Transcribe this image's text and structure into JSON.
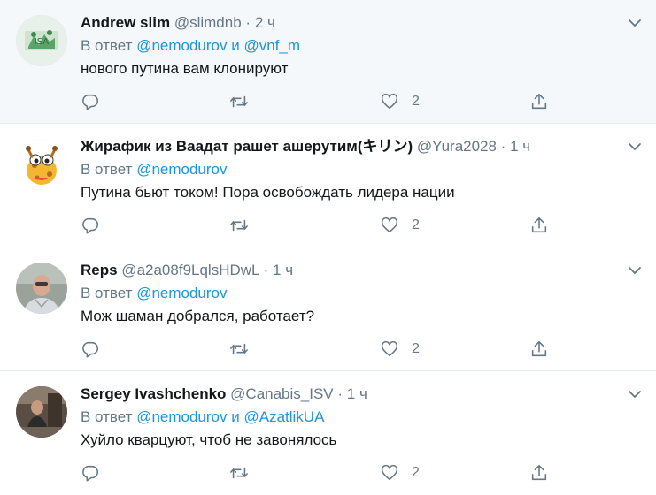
{
  "tweets": [
    {
      "name": "Andrew slim",
      "handle": "@slimdnb",
      "separator": "·",
      "time": "2 ч",
      "reply_prefix": "В ответ",
      "reply_to": [
        "@nemodurov",
        "@vnf_m"
      ],
      "reply_joiner": "и",
      "text": "нового путина вам клонируют",
      "likes": "2",
      "avatar": "green-pattern-avatar"
    },
    {
      "name": "Жирафик из Ваадат рашет ашерутим(キリン)",
      "handle": "@Yura2028",
      "separator": "·",
      "time": "1 ч",
      "reply_prefix": "В ответ",
      "reply_to": [
        "@nemodurov"
      ],
      "reply_joiner": "",
      "text": "Путина бьют током! Пора освобождать лидера нации",
      "likes": "2",
      "avatar": "giraffe-avatar"
    },
    {
      "name": "Reps",
      "handle": "@a2a08f9LqlsHDwL",
      "separator": "·",
      "time": "1 ч",
      "reply_prefix": "В ответ",
      "reply_to": [
        "@nemodurov"
      ],
      "reply_joiner": "",
      "text": "Мож шаман добрался, работает?",
      "likes": "2",
      "avatar": "man-photo-avatar"
    },
    {
      "name": "Sergey Ivashchenko",
      "handle": "@Canabis_ISV",
      "separator": "·",
      "time": "1 ч",
      "reply_prefix": "В ответ",
      "reply_to": [
        "@nemodurov",
        "@AzatlikUA"
      ],
      "reply_joiner": "и",
      "text": "Хуйло кварцуют, чтоб не завонялось",
      "likes": "2",
      "avatar": "dark-photo-avatar"
    }
  ],
  "icons": {
    "reply": "reply-icon",
    "retweet": "retweet-icon",
    "like": "heart-icon",
    "share": "share-icon",
    "menu": "chevron-down-icon"
  },
  "colors": {
    "link": "#1b95e0",
    "secondary": "#657786",
    "highlight_bg": "#f5f8fa",
    "divider": "#e6ecf0"
  }
}
